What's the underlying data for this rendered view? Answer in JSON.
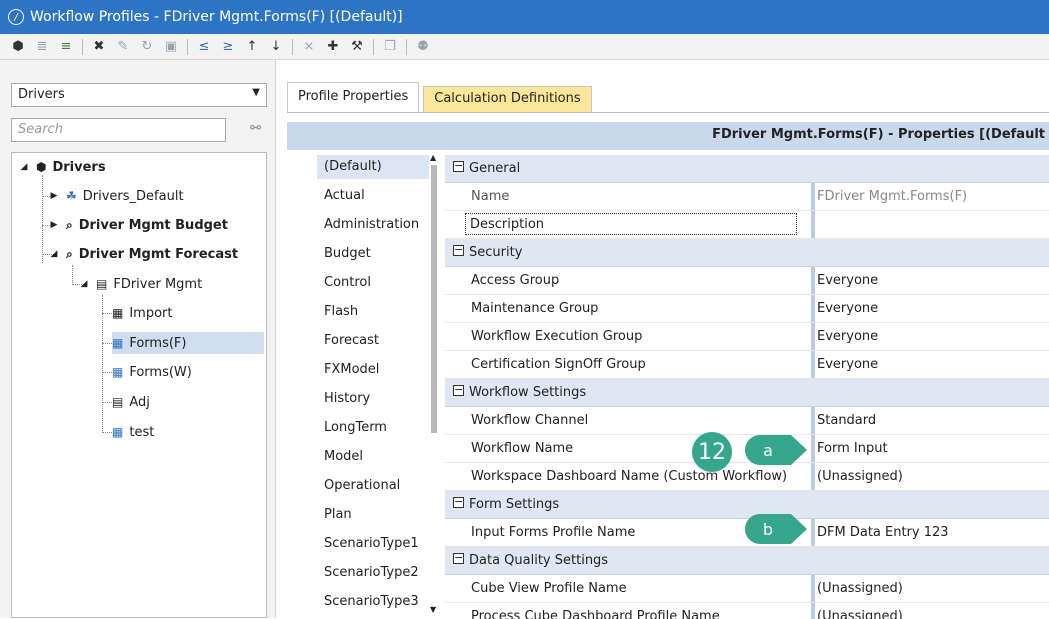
{
  "window": {
    "title": "Workflow Profiles - FDriver Mgmt.Forms(F) [(Default)]"
  },
  "toolbar": {
    "icons": [
      "cube-icon",
      "filter-icon",
      "insert-child-icon",
      "delete-icon",
      "edit-icon",
      "refresh-icon",
      "save-icon",
      "move-in-icon",
      "move-out-icon",
      "move-up-icon",
      "move-down-icon",
      "add-sibling-icon",
      "add-child-icon",
      "add-template-icon",
      "copy-icon",
      "search-binoculars-icon"
    ]
  },
  "left": {
    "dropdown_value": "Drivers",
    "search_placeholder": "Search",
    "tree": [
      {
        "label": "Drivers",
        "bold": true
      },
      {
        "label": "Drivers_Default",
        "bold": false
      },
      {
        "label": "Driver Mgmt Budget",
        "bold": true
      },
      {
        "label": "Driver Mgmt Forecast",
        "bold": true
      },
      {
        "label": "FDriver Mgmt",
        "bold": false
      },
      {
        "label": "Import",
        "bold": false
      },
      {
        "label": "Forms(F)",
        "bold": false,
        "selected": true
      },
      {
        "label": "Forms(W)",
        "bold": false
      },
      {
        "label": "Adj",
        "bold": false
      },
      {
        "label": "test",
        "bold": false
      }
    ]
  },
  "tabs": [
    {
      "label": "Profile Properties"
    },
    {
      "label": "Calculation Definitions"
    }
  ],
  "properties": {
    "header": "FDriver Mgmt.Forms(F) - Properties  [(Default",
    "scenario_types": [
      "(Default)",
      "Actual",
      "Administration",
      "Budget",
      "Control",
      "Flash",
      "Forecast",
      "FXModel",
      "History",
      "LongTerm",
      "Model",
      "Operational",
      "Plan",
      "ScenarioType1",
      "ScenarioType2",
      "ScenarioType3"
    ],
    "rows": [
      {
        "type": "cat",
        "key": "General"
      },
      {
        "type": "prop",
        "key": "Name",
        "value": "FDriver Mgmt.Forms(F)",
        "gray": true
      },
      {
        "type": "desc",
        "key": "Description",
        "value": ""
      },
      {
        "type": "cat",
        "key": "Security"
      },
      {
        "type": "prop",
        "key": "Access Group",
        "value": "Everyone"
      },
      {
        "type": "prop",
        "key": "Maintenance Group",
        "value": "Everyone"
      },
      {
        "type": "prop",
        "key": "Workflow Execution Group",
        "value": "Everyone"
      },
      {
        "type": "prop",
        "key": "Certification SignOff Group",
        "value": "Everyone"
      },
      {
        "type": "cat",
        "key": "Workflow Settings"
      },
      {
        "type": "prop",
        "key": "Workflow Channel",
        "value": "Standard"
      },
      {
        "type": "prop",
        "key": "Workflow Name",
        "value": "Form Input"
      },
      {
        "type": "prop",
        "key": "Workspace Dashboard Name (Custom Workflow)",
        "value": "(Unassigned)"
      },
      {
        "type": "cat",
        "key": "Form Settings"
      },
      {
        "type": "prop",
        "key": "Input Forms Profile Name",
        "value": "DFM Data Entry 123"
      },
      {
        "type": "cat",
        "key": "Data Quality Settings"
      },
      {
        "type": "prop",
        "key": "Cube View Profile Name",
        "value": "(Unassigned)"
      },
      {
        "type": "prop",
        "key": "Process Cube Dashboard Profile Name",
        "value": "(Unassigned)"
      }
    ]
  },
  "callouts": {
    "number": "12",
    "a": "a",
    "b": "b",
    "color": "#36a68c"
  }
}
